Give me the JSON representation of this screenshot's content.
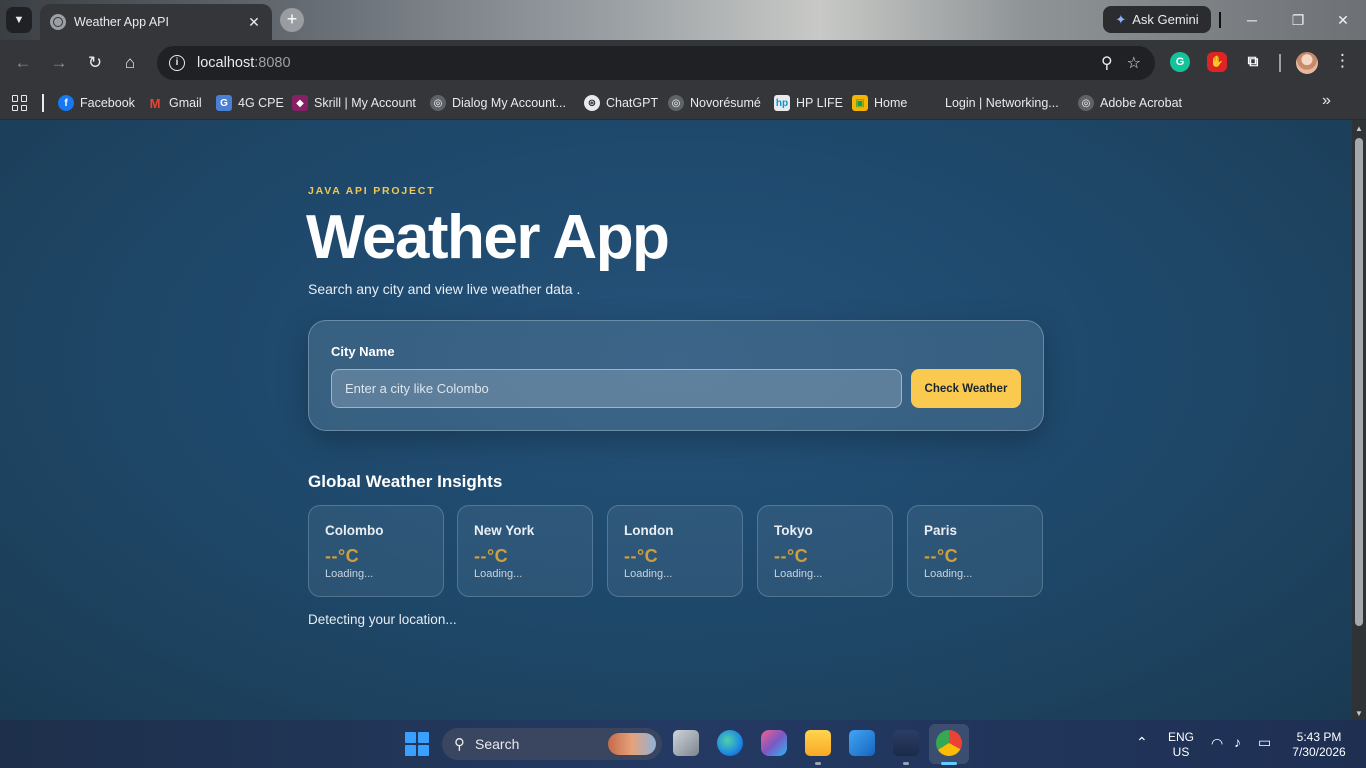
{
  "browser": {
    "tab_title": "Weather App API",
    "tab_close": "✕",
    "new_tab": "+",
    "ask_gemini": "Ask Gemini",
    "url_host": "localhost",
    "url_port": ":8080"
  },
  "bookmarks": [
    {
      "label": "Facebook",
      "icon": "facebook-icon",
      "color": "#1877f2"
    },
    {
      "label": "Gmail",
      "icon": "gmail-icon",
      "color": "#ea4335"
    },
    {
      "label": "4G CPE",
      "icon": "globe-icon",
      "color": "#4a7fd6"
    },
    {
      "label": "Skrill | My Account",
      "icon": "skrill-icon",
      "color": "#862165"
    },
    {
      "label": "Dialog My Account...",
      "icon": "globe-icon",
      "color": "#5f6368"
    },
    {
      "label": "ChatGPT",
      "icon": "chatgpt-icon",
      "color": "#5f6368"
    },
    {
      "label": "Novorésumé",
      "icon": "globe-icon",
      "color": "#5f6368"
    },
    {
      "label": "HP LIFE",
      "icon": "hp-life-icon",
      "color": "#e8eaed"
    },
    {
      "label": "Home",
      "icon": "classroom-icon",
      "color": "#f4b400"
    },
    {
      "label": "Login | Networking...",
      "icon": "",
      "color": ""
    },
    {
      "label": "Adobe Acrobat",
      "icon": "globe-icon",
      "color": "#5f6368"
    }
  ],
  "page": {
    "eyebrow": "JAVA API PROJECT",
    "title": "Weather App",
    "subtitle": "Search any city and view live weather data .",
    "search": {
      "label": "City Name",
      "placeholder": "Enter a city like Colombo",
      "value": "",
      "button": "Check Weather"
    },
    "insights_title": "Global Weather Insights",
    "cities": [
      {
        "name": "Colombo",
        "temp": "--°C",
        "status": "Loading..."
      },
      {
        "name": "New York",
        "temp": "--°C",
        "status": "Loading..."
      },
      {
        "name": "London",
        "temp": "--°C",
        "status": "Loading..."
      },
      {
        "name": "Tokyo",
        "temp": "--°C",
        "status": "Loading..."
      },
      {
        "name": "Paris",
        "temp": "--°C",
        "status": "Loading..."
      }
    ],
    "location_status": "Detecting your location..."
  },
  "taskbar": {
    "search_label": "Search",
    "lang_line1": "ENG",
    "lang_line2": "US",
    "time": "5:43 PM",
    "date": "7/30/2026"
  },
  "colors": {
    "accent": "#f9c950",
    "temp": "#cc9f42",
    "page_bg": "#1f4a6e"
  }
}
